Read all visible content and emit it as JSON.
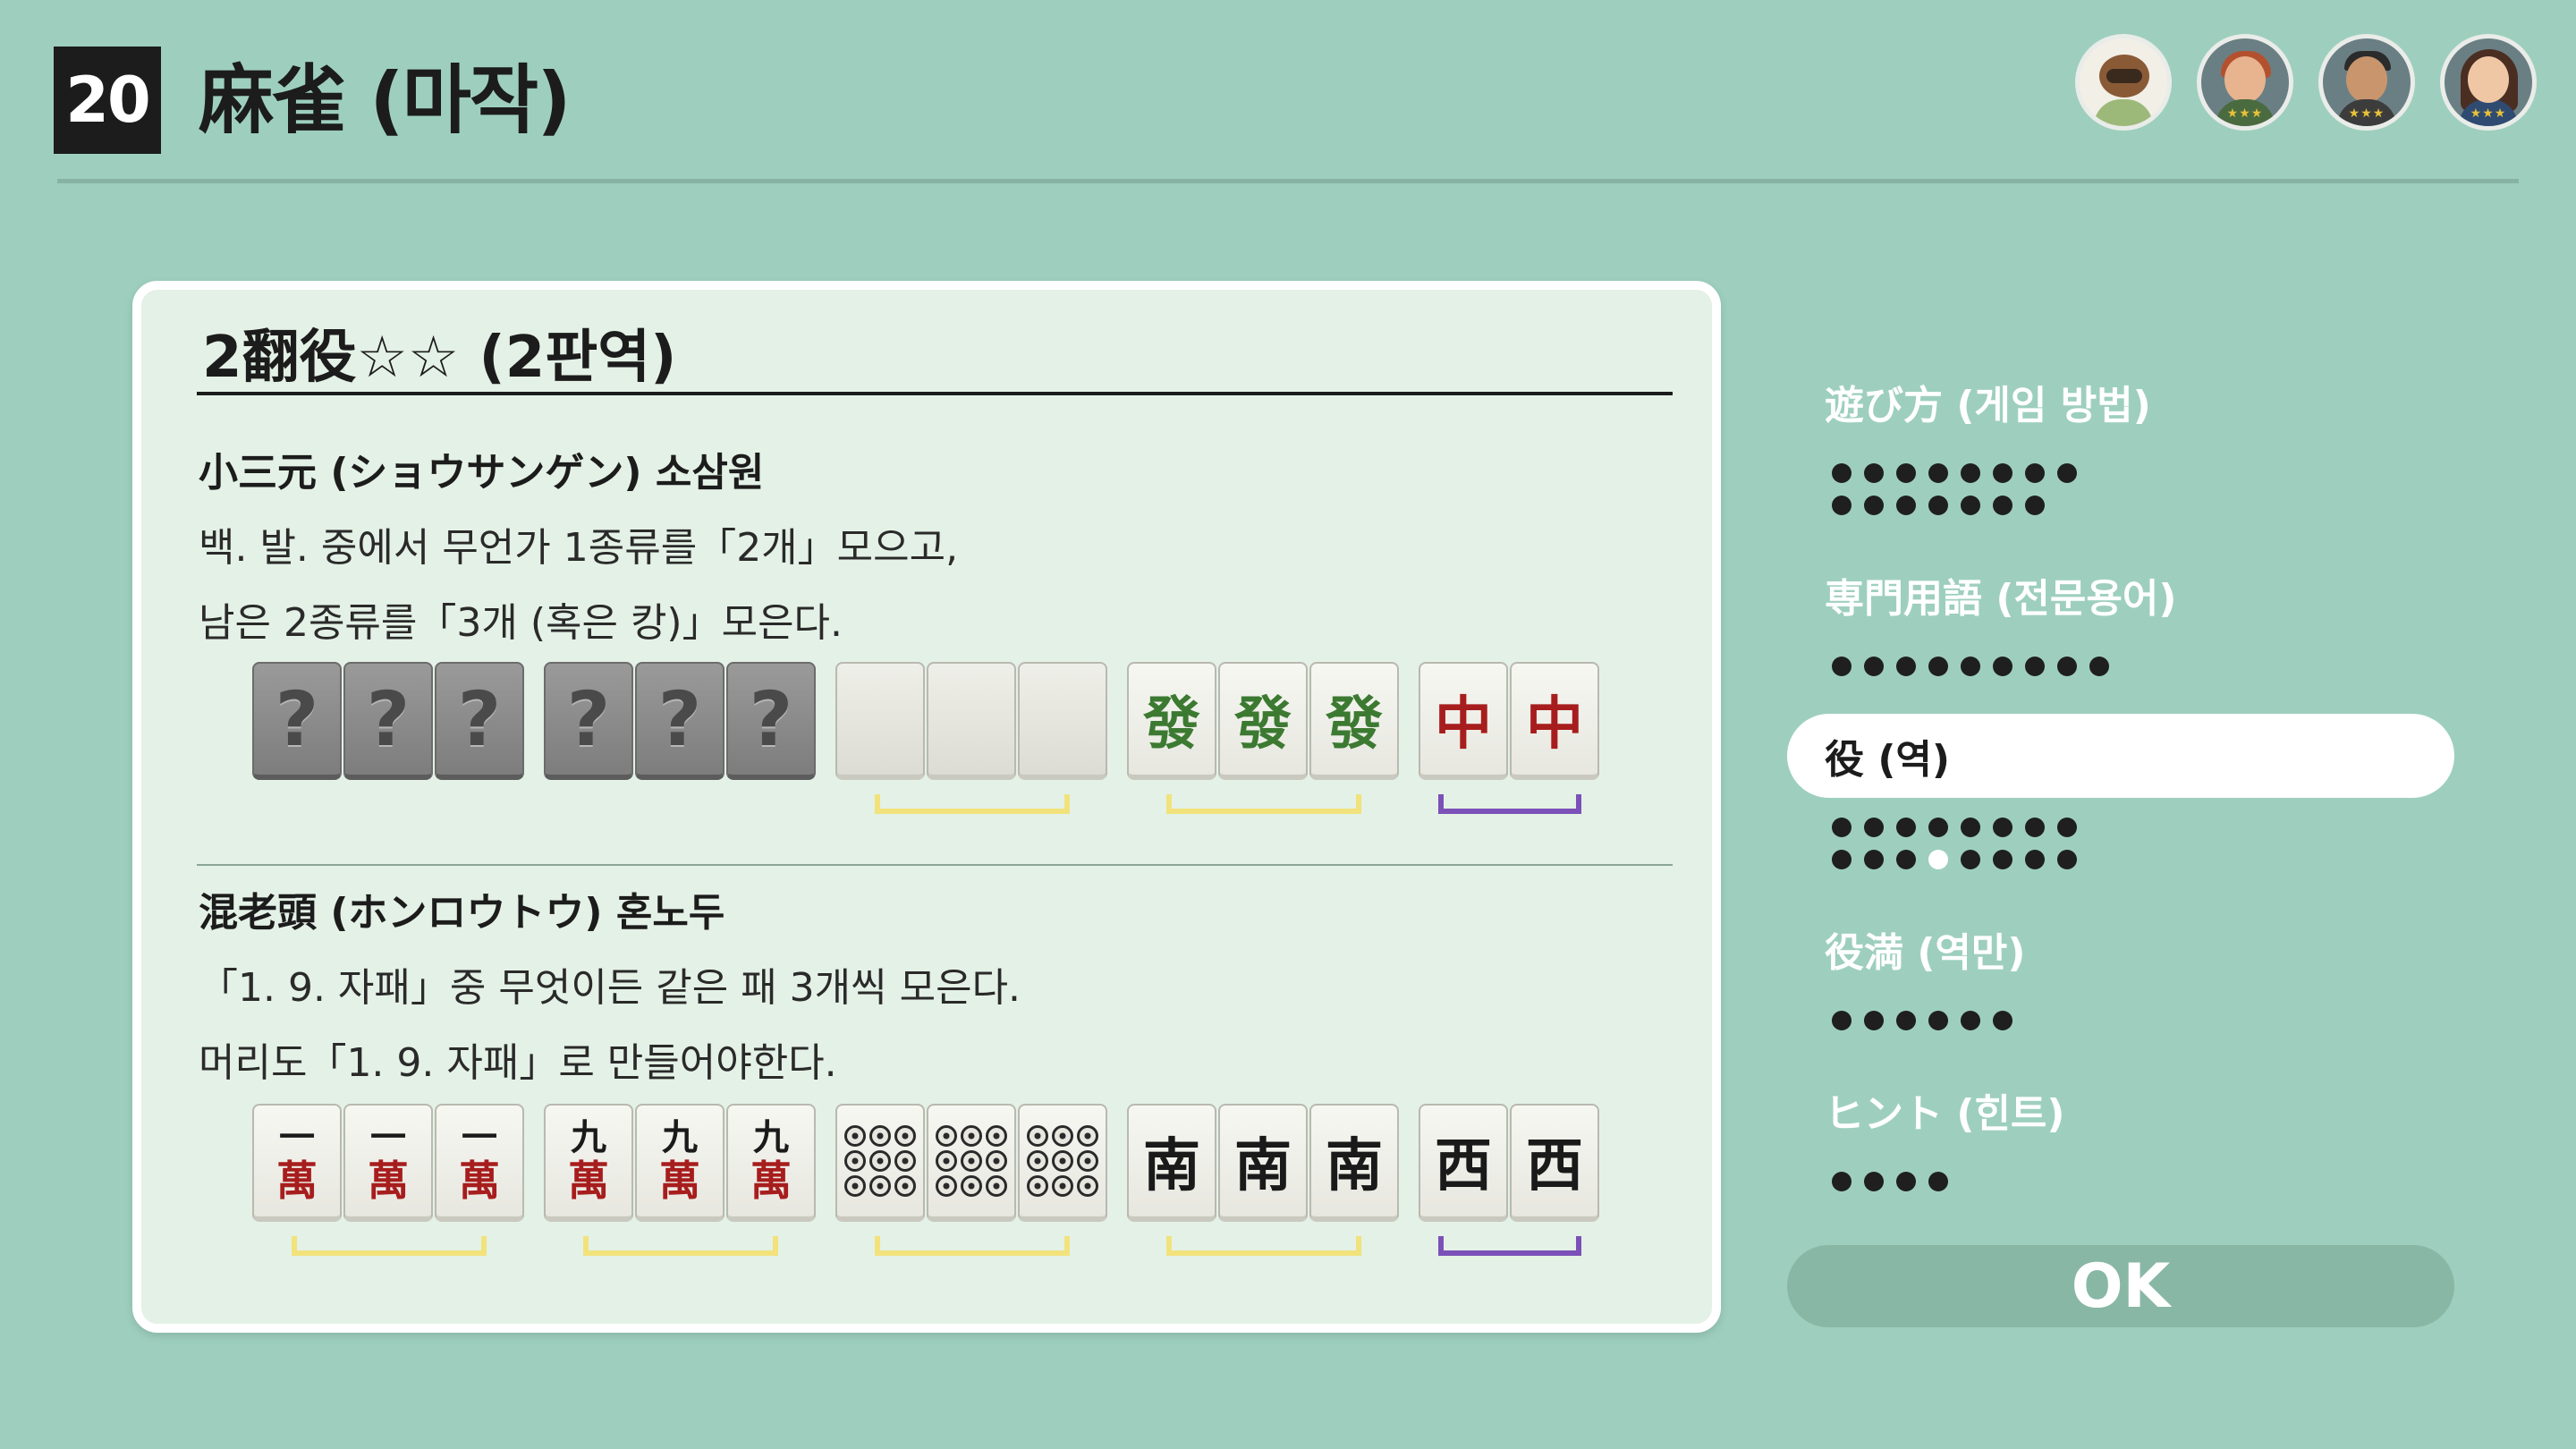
{
  "header": {
    "game_number": "20",
    "title": "麻雀 (마작)"
  },
  "players": [
    {
      "name": "avatar-raccoon",
      "stars": ""
    },
    {
      "name": "avatar-red-hair",
      "stars": "★★★"
    },
    {
      "name": "avatar-dark-hair",
      "stars": "★★★"
    },
    {
      "name": "avatar-glasses",
      "stars": "★★★"
    }
  ],
  "panel": {
    "title": "2翻役☆☆ (2판역)",
    "sections": [
      {
        "name": "小三元 (ショウサンゲン) 소삼원",
        "line1": "백. 발. 중에서 무언가 1종류를「2개」모으고,",
        "line2": "남은 2종류를「3개 (혹은 캉)」모은다.",
        "tiles": [
          {
            "type": "unknown",
            "label": "?"
          },
          {
            "type": "unknown",
            "label": "?"
          },
          {
            "type": "unknown",
            "label": "?"
          },
          {
            "type": "unknown",
            "label": "?"
          },
          {
            "type": "unknown",
            "label": "?"
          },
          {
            "type": "unknown",
            "label": "?"
          },
          {
            "type": "blank",
            "label": ""
          },
          {
            "type": "blank",
            "label": ""
          },
          {
            "type": "blank",
            "label": ""
          },
          {
            "type": "green",
            "label": "發"
          },
          {
            "type": "green",
            "label": "發"
          },
          {
            "type": "green",
            "label": "發"
          },
          {
            "type": "red",
            "label": "中"
          },
          {
            "type": "red",
            "label": "中"
          }
        ]
      },
      {
        "name": "混老頭 (ホンロウトウ) 혼노두",
        "line1": "「1. 9. 자패」중 무엇이든 같은 패 3개씩 모은다.",
        "line2": "머리도「1. 9. 자패」로 만들어야한다.",
        "tiles": [
          {
            "type": "man",
            "num": "一",
            "kanji": "萬"
          },
          {
            "type": "man",
            "num": "一",
            "kanji": "萬"
          },
          {
            "type": "man",
            "num": "一",
            "kanji": "萬"
          },
          {
            "type": "man",
            "num": "九",
            "kanji": "萬"
          },
          {
            "type": "man",
            "num": "九",
            "kanji": "萬"
          },
          {
            "type": "man",
            "num": "九",
            "kanji": "萬"
          },
          {
            "type": "pin9"
          },
          {
            "type": "pin9"
          },
          {
            "type": "pin9"
          },
          {
            "type": "black",
            "label": "南"
          },
          {
            "type": "black",
            "label": "南"
          },
          {
            "type": "black",
            "label": "南"
          },
          {
            "type": "black",
            "label": "西"
          },
          {
            "type": "black",
            "label": "西"
          }
        ]
      }
    ]
  },
  "menu": {
    "items": [
      {
        "label": "遊び方 (게임 방법)",
        "active": false,
        "dots": 15,
        "current": -1
      },
      {
        "label": "専門用語 (전문용어)",
        "active": false,
        "dots": 9,
        "current": -1
      },
      {
        "label": "役 (역)",
        "active": true,
        "dots": 16,
        "current": 11
      },
      {
        "label": "役満 (역만)",
        "active": false,
        "dots": 6,
        "current": -1
      },
      {
        "label": "ヒント (힌트)",
        "active": false,
        "dots": 4,
        "current": -1
      }
    ],
    "ok_label": "OK"
  },
  "colors": {
    "background": "#9ecfbe",
    "panel": "#e4f1e6",
    "bracket_yellow": "#f2e27c",
    "bracket_purple": "#7b51b8"
  }
}
